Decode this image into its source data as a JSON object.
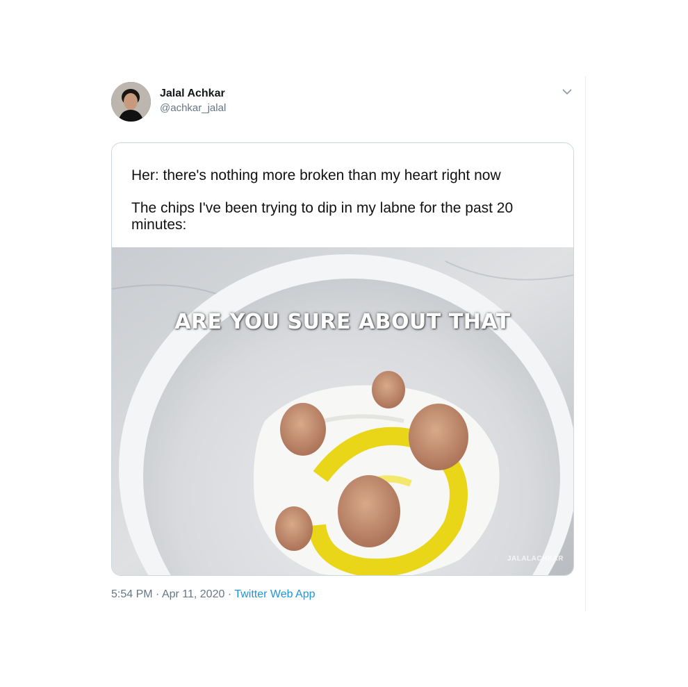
{
  "author": {
    "display_name": "Jalal Achkar",
    "handle": "@achkar_jalal"
  },
  "tweet": {
    "line1": "Her:  there's nothing more broken than my heart right now",
    "line2": "The chips I've been trying to dip in my labne for the past 20 minutes:"
  },
  "image": {
    "caption": "ARE YOU SURE ABOUT THAT",
    "watermark": "JALALACHKAR"
  },
  "meta": {
    "time": "5:54 PM",
    "separator": " · ",
    "date": "Apr 11, 2020",
    "app": "Twitter Web App"
  },
  "icons": {
    "menu": "chevron-down-icon"
  },
  "colors": {
    "link": "#1b95e0",
    "secondary_text": "#657786",
    "border": "#ccd6dd",
    "oil": "#e8d200"
  }
}
